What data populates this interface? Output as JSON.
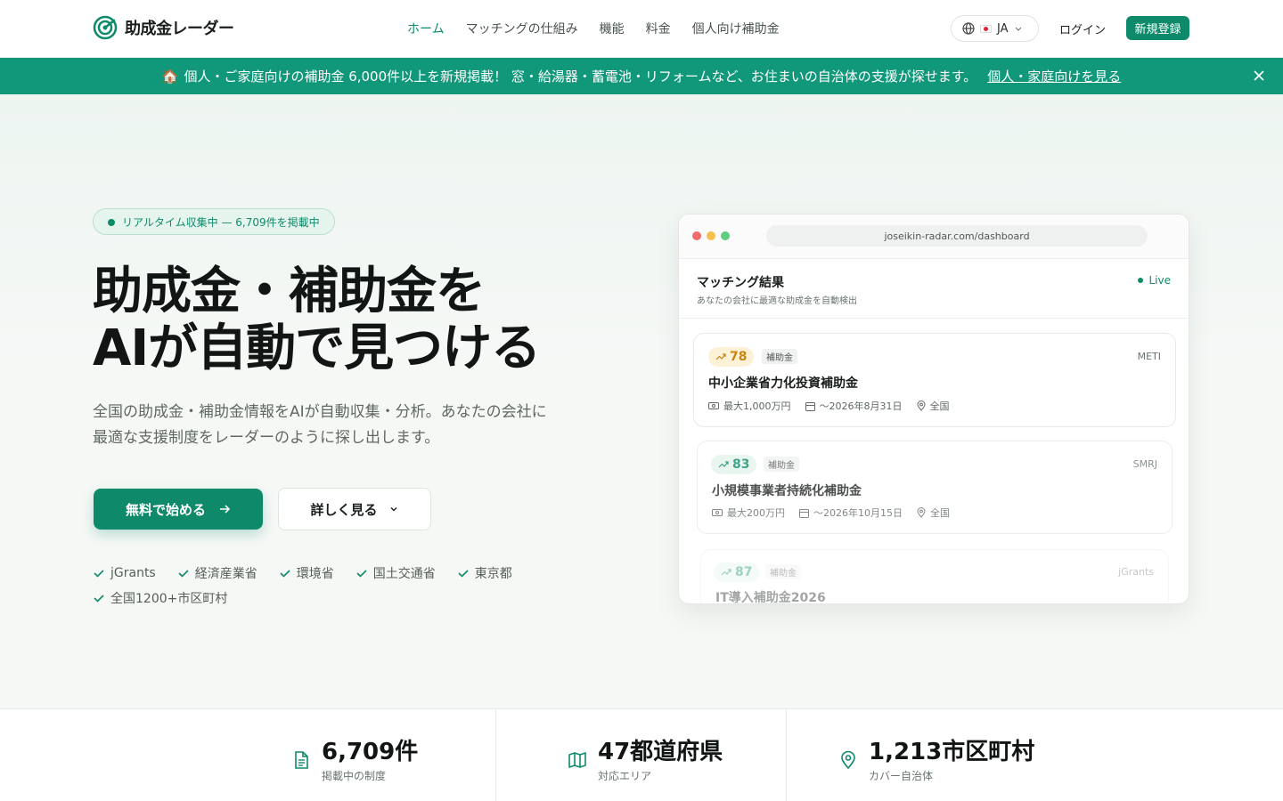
{
  "nav": {
    "logo": "助成金レーダー",
    "links": [
      "ホーム",
      "マッチングの仕組み",
      "機能",
      "料金",
      "個人向け補助金"
    ],
    "lang": "JA",
    "login": "ログイン",
    "signup": "新規登録"
  },
  "banner": {
    "emoji": "🏠",
    "text": "個人・ご家庭向けの補助金 6,000件以上を新規掲載！ 窓・給湯器・蓄電池・リフォームなど、お住まいの自治体の支援が探せます。",
    "link": "個人・家庭向けを見る"
  },
  "hero": {
    "pill": "リアルタイム収集中 — 6,709件を掲載中",
    "headline_1": "助成金・補助金を",
    "headline_2": "AIが自動で見つける",
    "sub": "全国の助成金・補助金情報をAIが自動収集・分析。あなたの会社に最適な支援制度をレーダーのように探し出します。",
    "cta_primary": "無料で始める",
    "cta_secondary": "詳しく見る",
    "sources": [
      "jGrants",
      "経済産業省",
      "環境省",
      "国土交通省",
      "東京都",
      "全国1200+市区町村"
    ]
  },
  "mock": {
    "url": "joseikin-radar.com/dashboard",
    "title": "マッチング結果",
    "subtitle": "あなたの会社に最適な助成金を自動検出",
    "live": "Live",
    "cards": [
      {
        "score": "78",
        "tag": "補助金",
        "agency": "METI",
        "title": "中小企業省力化投資補助金",
        "amount": "最大1,000万円",
        "deadline": "〜2026年8月31日",
        "area": "全国"
      },
      {
        "score": "83",
        "tag": "補助金",
        "agency": "SMRJ",
        "title": "小規模事業者持続化補助金",
        "amount": "最大200万円",
        "deadline": "〜2026年10月15日",
        "area": "全国"
      },
      {
        "score": "87",
        "tag": "補助金",
        "agency": "jGrants",
        "title": "IT導入補助金2026"
      }
    ]
  },
  "stats": [
    {
      "value": "6,709件",
      "label": "掲載中の制度"
    },
    {
      "value": "47都道府県",
      "label": "対応エリア"
    },
    {
      "value": "1,213市区町村",
      "label": "カバー自治体"
    }
  ],
  "colors": {
    "brand": "#0e8a6a",
    "banner": "#11977a"
  }
}
